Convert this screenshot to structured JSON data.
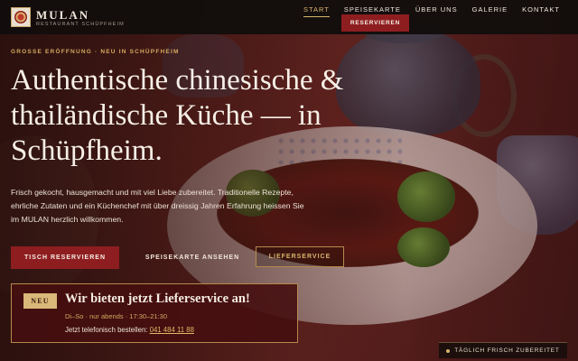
{
  "header": {
    "brand_name": "MULAN",
    "brand_tagline": "RESTAURANT SCHÜPFHEIM",
    "logo_icon": "mulan-logo-icon",
    "nav": [
      {
        "label": "START",
        "active": true
      },
      {
        "label": "SPEISEKARTE",
        "active": false
      },
      {
        "label": "ÜBER UNS",
        "active": false
      },
      {
        "label": "GALERIE",
        "active": false
      },
      {
        "label": "KONTAKT",
        "active": false
      }
    ],
    "reserve_label": "RESERVIEREN"
  },
  "hero": {
    "eyebrow": "GROSSE ERÖFFNUNG · NEU IN SCHÜPFHEIM",
    "headline": "Authentische chinesische & thailändische Küche — in Schüpfheim.",
    "lead": "Frisch gekocht, hausgemacht und mit viel Liebe zubereitet. Traditionelle Rezepte, ehrliche Zutaten und ein Küchenchef mit über dreissig Jahren Erfahrung heissen Sie im MULAN herzlich willkommen.",
    "buttons": {
      "reserve": "TISCH RESERVIEREN",
      "menu": "SPEISEKARTE ANSEHEN",
      "delivery": "LIEFERSERVICE"
    }
  },
  "delivery_card": {
    "badge": "NEU",
    "title": "Wir bieten jetzt Lieferservice an!",
    "hours": "Di–So · nur abends · 17:30–21:30",
    "order_text": "Jetzt telefonisch bestellen:",
    "phone": "041 484 11 88"
  },
  "fresh_badge": {
    "label": "TÄGLICH FRISCH ZUBEREITET"
  },
  "colors": {
    "accent_red": "#8e1d20",
    "accent_gold": "#d9b46c",
    "header_bg": "#120e0c"
  }
}
